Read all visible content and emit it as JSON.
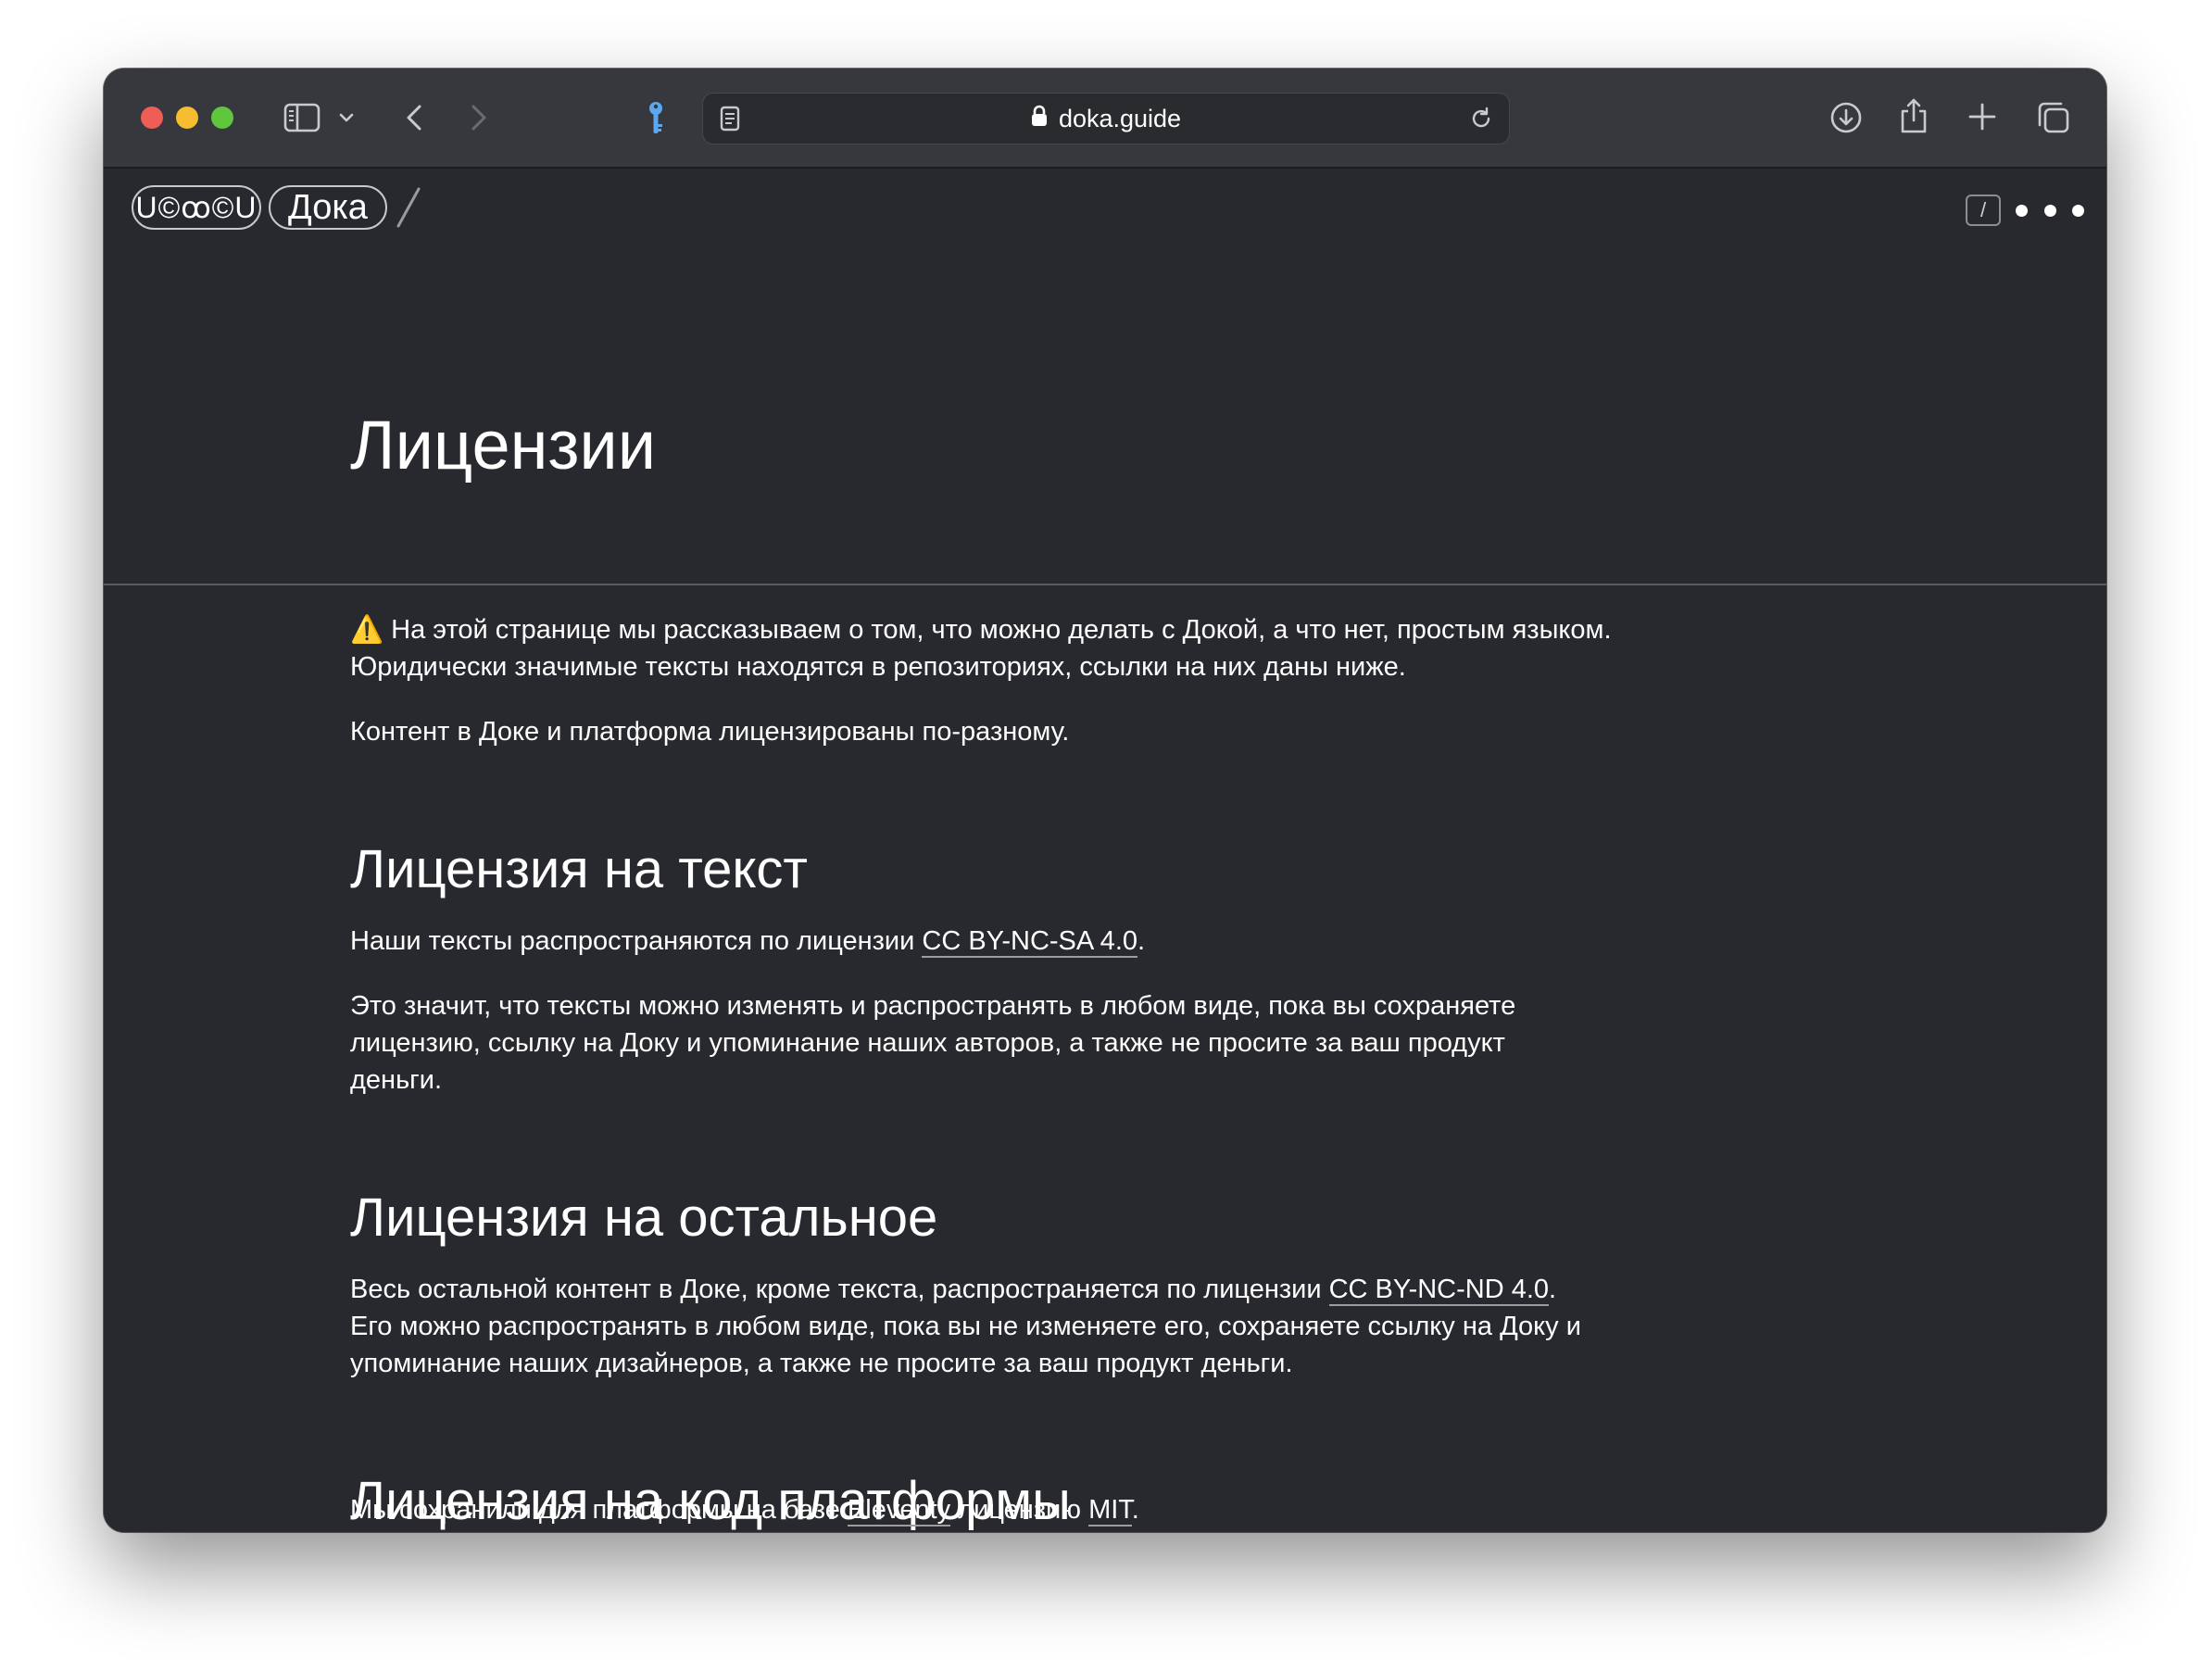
{
  "browser": {
    "url": "doka.guide",
    "colors": {
      "close": "#ee5e57",
      "minimize": "#f5bd2f",
      "zoom": "#5fc63d"
    },
    "icons": [
      "sidebar-icon",
      "chevron-down-icon",
      "back-icon",
      "forward-icon",
      "key-icon",
      "reader-icon",
      "lock-icon",
      "reload-icon",
      "download-icon",
      "share-icon",
      "plus-icon",
      "tabs-overview-icon"
    ]
  },
  "site_header": {
    "logo_text": "U©ꝏ©U",
    "home_label": "Дока",
    "separator": "/",
    "search_key": "/"
  },
  "article": {
    "title": "Лицензии",
    "warning_icon": "⚠️",
    "intro_line1": "На этой странице мы рассказываем о том, что можно делать с Докой, а что нет, простым языком.",
    "intro_line2": "Юридически значимые тексты находятся в репозиториях, ссылки на них даны ниже.",
    "intro_p2": "Контент в Доке и платформа лицензированы по-разному.",
    "sections": [
      {
        "heading": "Лицензия на текст",
        "p1_before": "Наши тексты распространяются по лицензии ",
        "p1_link": "CC BY-NC-SA 4.0",
        "p1_after": ".",
        "p2_line1": "Это значит, что тексты можно изменять и распространять в любом виде, пока вы сохраняете",
        "p2_line2": "лицензию, ссылку на Доку и упоминание наших авторов, а также не просите за ваш продукт",
        "p2_line3": "деньги."
      },
      {
        "heading": "Лицензия на остальное",
        "line1_before": "Весь остальной контент в Доке, кроме текста, распространяется по лицензии ",
        "line1_link": "CC BY-NC-ND 4.0",
        "line1_after": ".",
        "line2": "Его можно распространять в любом виде, пока вы не изменяете его, сохраняете ссылку на Доку и",
        "line3": "упоминание наших дизайнеров, а также не просите за ваш продукт деньги."
      },
      {
        "heading": "Лицензия на код платформы",
        "p_before": "Мы сохранили для платформы на базе ",
        "p_link1": "Eleventy",
        "p_middle": " лицензию ",
        "p_link2": "MIT",
        "p_after": "."
      }
    ]
  }
}
